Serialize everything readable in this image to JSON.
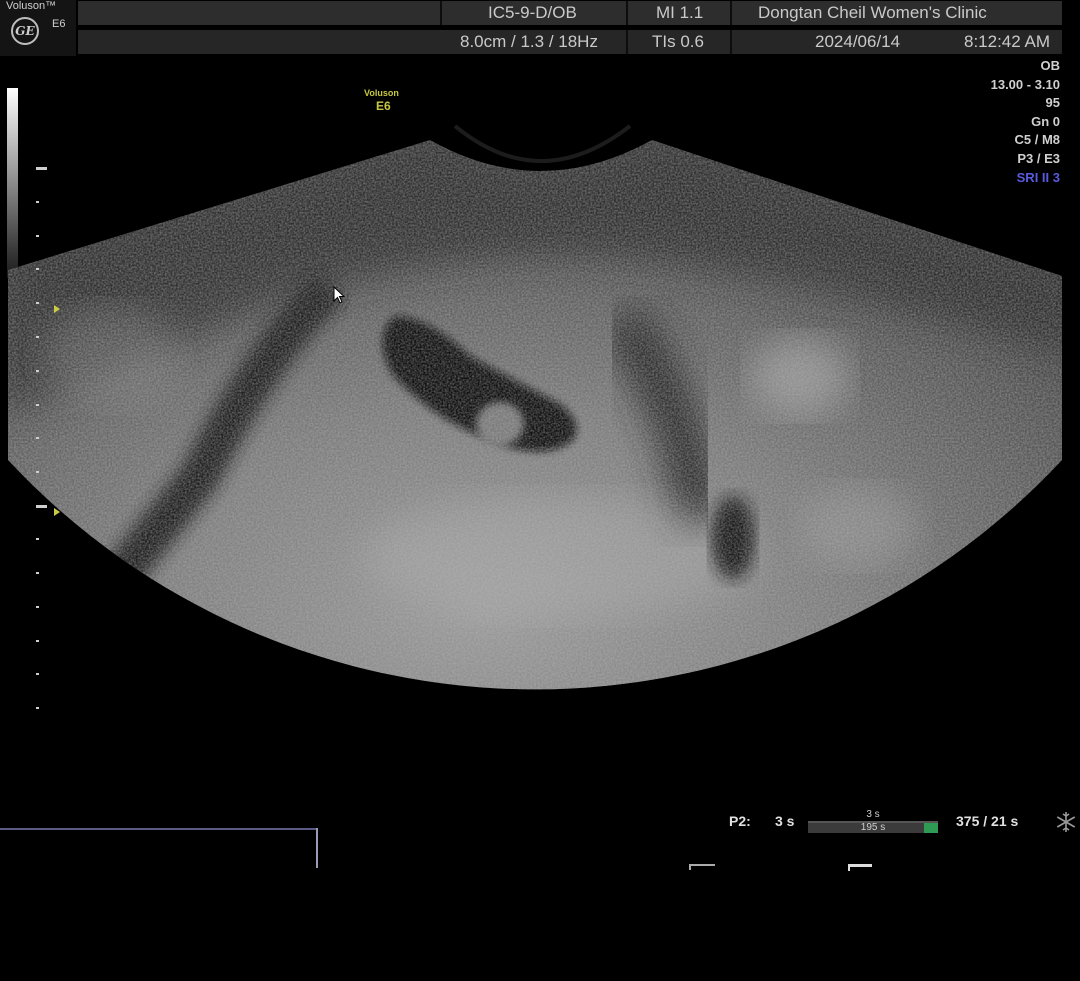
{
  "header": {
    "brand_name": "Voluson™",
    "brand_model": "E6",
    "logo": "GE",
    "probe": "IC5-9-D/OB",
    "mi": "MI  1.1",
    "clinic": "Dongtan Cheil Women's Clinic",
    "depth_info": "8.0cm / 1.3 / 18Hz",
    "tis": "TIs  0.6",
    "date": "2024/06/14",
    "time": "8:12:42 AM"
  },
  "params": {
    "mode": "OB",
    "freq": "13.00 - 3.10",
    "power": "95",
    "gain": "Gn   0",
    "cm": "C5 / M8",
    "pe": "P3 / E3",
    "sri": "SRI II 3"
  },
  "watermark": {
    "name": "Voluson",
    "model": "E6"
  },
  "cine": {
    "label": "P2:",
    "value1": "3 s",
    "bar_top": "3 s",
    "bar_bottom": "195 s",
    "frames": "375 / 21 s",
    "position_fraction": 0.9
  },
  "icons": {
    "logo": "ge-logo-icon",
    "freeze": "snowflake-icon",
    "cursor": "mouse-pointer-icon"
  },
  "colors": {
    "watermark": "#c8c840",
    "sri": "#5a5adf",
    "cine_end": "#2e9a54"
  }
}
